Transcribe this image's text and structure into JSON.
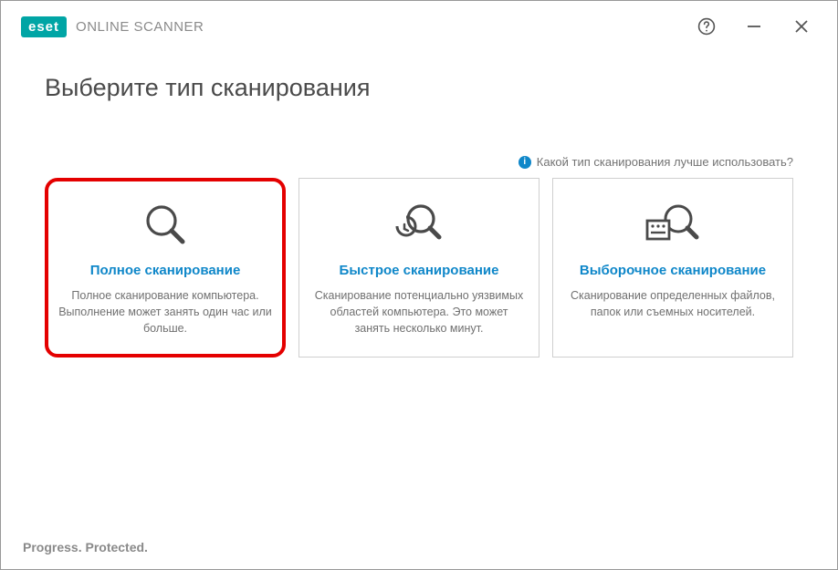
{
  "brand": {
    "logo_text": "eset",
    "product": "ONLINE SCANNER",
    "tagline": "Progress. Protected."
  },
  "page_title": "Выберите тип сканирования",
  "help_link": "Какой тип сканирования лучше использовать?",
  "cards": [
    {
      "title": "Полное сканирование",
      "desc": "Полное сканирование компьютера. Выполнение может занять один час или больше.",
      "highlighted": true,
      "icon": "magnifier-icon"
    },
    {
      "title": "Быстрое сканирование",
      "desc": "Сканирование потенциально уязвимых областей компьютера. Это может занять несколько минут.",
      "highlighted": false,
      "icon": "magnifier-clock-icon"
    },
    {
      "title": "Выборочное сканирование",
      "desc": "Сканирование определенных файлов, папок или съемных носителей.",
      "highlighted": false,
      "icon": "magnifier-list-icon"
    }
  ]
}
